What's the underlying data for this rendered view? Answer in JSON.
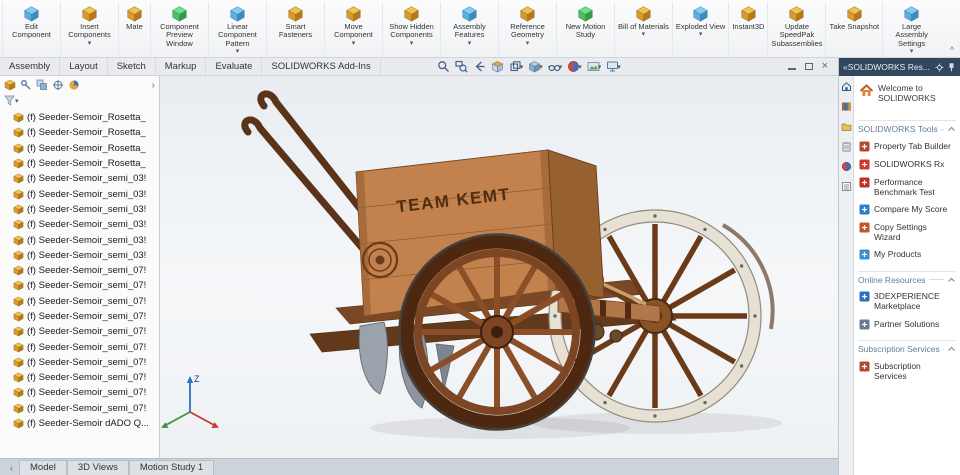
{
  "ribbon": {
    "collapse_label": "^",
    "buttons": [
      {
        "label": "Edit Component",
        "icon": "edit-component-icon",
        "arrow": ""
      },
      {
        "label": "Insert Components",
        "icon": "insert-components-icon",
        "arrow": "▾"
      },
      {
        "label": "Mate",
        "icon": "mate-icon",
        "arrow": ""
      },
      {
        "label": "Component Preview Window",
        "icon": "component-preview-window-icon",
        "arrow": ""
      },
      {
        "label": "Linear Component Pattern",
        "icon": "linear-component-pattern-icon",
        "arrow": "▾"
      },
      {
        "label": "Smart Fasteners",
        "icon": "smart-fasteners-icon",
        "arrow": ""
      },
      {
        "label": "Move Component",
        "icon": "move-component-icon",
        "arrow": "▾"
      },
      {
        "label": "Show Hidden Components",
        "icon": "show-hidden-components-icon",
        "arrow": "▾"
      },
      {
        "label": "Assembly Features",
        "icon": "assembly-features-icon",
        "arrow": "▾"
      },
      {
        "label": "Reference Geometry",
        "icon": "reference-geometry-icon",
        "arrow": "▾"
      },
      {
        "label": "New Motion Study",
        "icon": "new-motion-study-icon",
        "arrow": ""
      },
      {
        "label": "Bill of Materials",
        "icon": "bill-of-materials-icon",
        "arrow": "▾"
      },
      {
        "label": "Exploded View",
        "icon": "exploded-view-icon",
        "arrow": "▾"
      },
      {
        "label": "Instant3D",
        "icon": "instant3d-icon",
        "arrow": ""
      },
      {
        "label": "Update SpeedPak Subassemblies",
        "icon": "update-speedpak-subassemblies-icon",
        "arrow": ""
      },
      {
        "label": "Take Snapshot",
        "icon": "take-snapshot-icon",
        "arrow": ""
      },
      {
        "label": "Large Assembly Settings",
        "icon": "large-assembly-settings-icon",
        "arrow": "▾"
      }
    ]
  },
  "command_tabs": [
    "Assembly",
    "Layout",
    "Sketch",
    "Markup",
    "Evaluate",
    "SOLIDWORKS Add-Ins"
  ],
  "heads_up_toolbar_icons": [
    "zoom-fit-icon",
    "zoom-area-icon",
    "previous-view-icon",
    "section-view-icon",
    "view-orientation-icon",
    "display-style-icon",
    "hide-show-items-icon",
    "edit-appearance-icon",
    "apply-scene-icon",
    "view-settings-icon"
  ],
  "window_control_icons": [
    "minimize-icon",
    "restore-icon",
    "close-icon"
  ],
  "feature_tree": {
    "items": [
      "(f) Seeder-Semoir_Rosetta_",
      "(f) Seeder-Semoir_Rosetta_",
      "(f) Seeder-Semoir_Rosetta_",
      "(f) Seeder-Semoir_Rosetta_",
      "(f) Seeder-Semoir_semi_03!",
      "(f) Seeder-Semoir_semi_03!",
      "(f) Seeder-Semoir_semi_03!",
      "(f) Seeder-Semoir_semi_03!",
      "(f) Seeder-Semoir_semi_03!",
      "(f) Seeder-Semoir_semi_03!",
      "(f) Seeder-Semoir_semi_07!",
      "(f) Seeder-Semoir_semi_07!",
      "(f) Seeder-Semoir_semi_07!",
      "(f) Seeder-Semoir_semi_07!",
      "(f) Seeder-Semoir_semi_07!",
      "(f) Seeder-Semoir_semi_07!",
      "(f) Seeder-Semoir_semi_07!",
      "(f) Seeder-Semoir_semi_07!",
      "(f) Seeder-Semoir_semi_07!",
      "(f) Seeder-Semoir_semi_07!",
      "(f) Seeder-Semoir dADO Q..."
    ]
  },
  "viewport": {
    "model_text": "TEAM KEMT",
    "triad_z_label": "Z"
  },
  "task_pane": {
    "header": "«SOLIDWORKS Res...",
    "welcome": "Welcome to SOLIDWORKS",
    "sections": [
      {
        "title": "SOLIDWORKS Tools",
        "items": [
          {
            "label": "Property Tab Builder",
            "icon": "property-tab-builder-icon",
            "color": "#b5492f"
          },
          {
            "label": "SOLIDWORKS Rx",
            "icon": "solidworks-rx-icon",
            "color": "#cf3a2c"
          },
          {
            "label": "Performance Benchmark Test",
            "icon": "performance-benchmark-test-icon",
            "color": "#c03028"
          },
          {
            "label": "Compare My Score",
            "icon": "compare-my-score-icon",
            "color": "#2d7fc1"
          },
          {
            "label": "Copy Settings Wizard",
            "icon": "copy-settings-wizard-icon",
            "color": "#c0572e"
          },
          {
            "label": "My Products",
            "icon": "my-products-icon",
            "color": "#3a8fd0"
          }
        ]
      },
      {
        "title": "Online Resources",
        "items": [
          {
            "label": "3DEXPERIENCE Marketplace",
            "icon": "3dexperience-marketplace-icon",
            "color": "#2a6fc0"
          },
          {
            "label": "Partner Solutions",
            "icon": "partner-solutions-icon",
            "color": "#6a7b8c"
          }
        ]
      },
      {
        "title": "Subscription Services",
        "items": [
          {
            "label": "Subscription Services",
            "icon": "subscription-services-icon",
            "color": "#b5492f"
          }
        ]
      }
    ]
  },
  "task_pane_tab_icons": [
    "solidworks-resources-tab-icon",
    "design-library-tab-icon",
    "file-explorer-tab-icon",
    "view-palette-tab-icon",
    "appearances-scenes-tab-icon",
    "custom-properties-tab-icon"
  ],
  "bottom_tabs": [
    "Model",
    "3D Views",
    "Motion Study 1"
  ]
}
